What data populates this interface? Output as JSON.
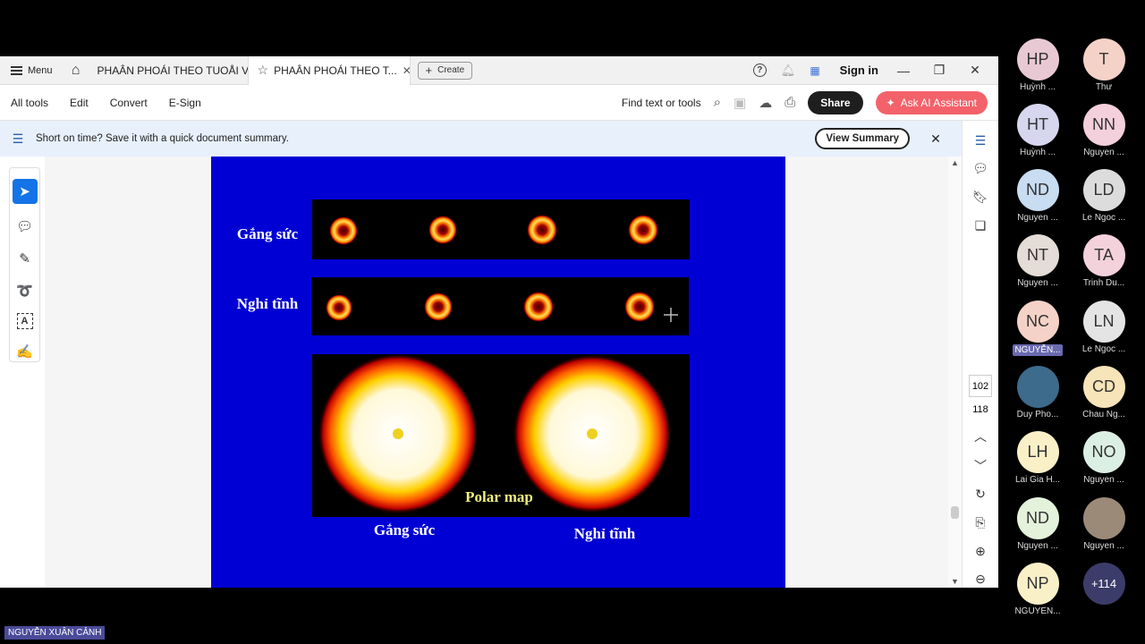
{
  "tabbar": {
    "menu_label": "Menu",
    "tab1_label": "PHAÂN PHOÁI THEO TUOÅI VA...",
    "tab2_label": "PHAÂN PHOÁI THEO T...",
    "create_label": "Create",
    "signin_label": "Sign in"
  },
  "toolbar": {
    "all_tools": "All tools",
    "edit": "Edit",
    "convert": "Convert",
    "esign": "E-Sign",
    "find": "Find text or tools",
    "share": "Share",
    "ai": "Ask AI Assistant"
  },
  "banner": {
    "text": "Short on time? Save it with a quick document summary.",
    "button": "View Summary"
  },
  "slide": {
    "row1_label": "Gắng sức",
    "row2_label": "Nghỉ tĩnh",
    "polar_label": "Polar map",
    "caption_left": "Gắng sức",
    "caption_right": "Nghỉ tĩnh"
  },
  "pager": {
    "current": "102",
    "total": "118"
  },
  "participants": [
    {
      "initials": "HP",
      "name": "Huỳnh ...",
      "color": "#e8c9d3"
    },
    {
      "initials": "T",
      "name": "Thư",
      "color": "#f5d2c8"
    },
    {
      "initials": "HT",
      "name": "Huỳnh ...",
      "color": "#d6d6ee"
    },
    {
      "initials": "NN",
      "name": "Nguyen ...",
      "color": "#f4cfdc"
    },
    {
      "initials": "ND",
      "name": "Nguyen ...",
      "color": "#c8dcf2"
    },
    {
      "initials": "LD",
      "name": "Le Ngoc ...",
      "color": "#dcdcdc"
    },
    {
      "initials": "NT",
      "name": "Nguyen ...",
      "color": "#e4dcd6"
    },
    {
      "initials": "TA",
      "name": "Trinh Du...",
      "color": "#f4d2dc"
    },
    {
      "initials": "NC",
      "name": "NGUYỄN...",
      "color": "#f5d2c8"
    },
    {
      "initials": "LN",
      "name": "Le Ngoc ...",
      "color": "#e4e4e4"
    },
    {
      "initials": "",
      "name": "Duy Pho...",
      "color": "#3d6b8c"
    },
    {
      "initials": "CD",
      "name": "Chau Ng...",
      "color": "#f7e4b8"
    },
    {
      "initials": "LH",
      "name": "Lai Gia H...",
      "color": "#faf0c8"
    },
    {
      "initials": "NO",
      "name": "Nguyen ...",
      "color": "#dcefe4"
    },
    {
      "initials": "ND",
      "name": "Nguyen ...",
      "color": "#e4f2dc"
    },
    {
      "initials": "",
      "name": "Nguyen ...",
      "color": "#9c8a78"
    },
    {
      "initials": "NP",
      "name": "NGUYEN...",
      "color": "#faf0c8"
    },
    {
      "initials": "+114",
      "name": "",
      "color": "#3c3c6a"
    }
  ],
  "nameplate": "NGUYỄN XUÂN CẢNH"
}
